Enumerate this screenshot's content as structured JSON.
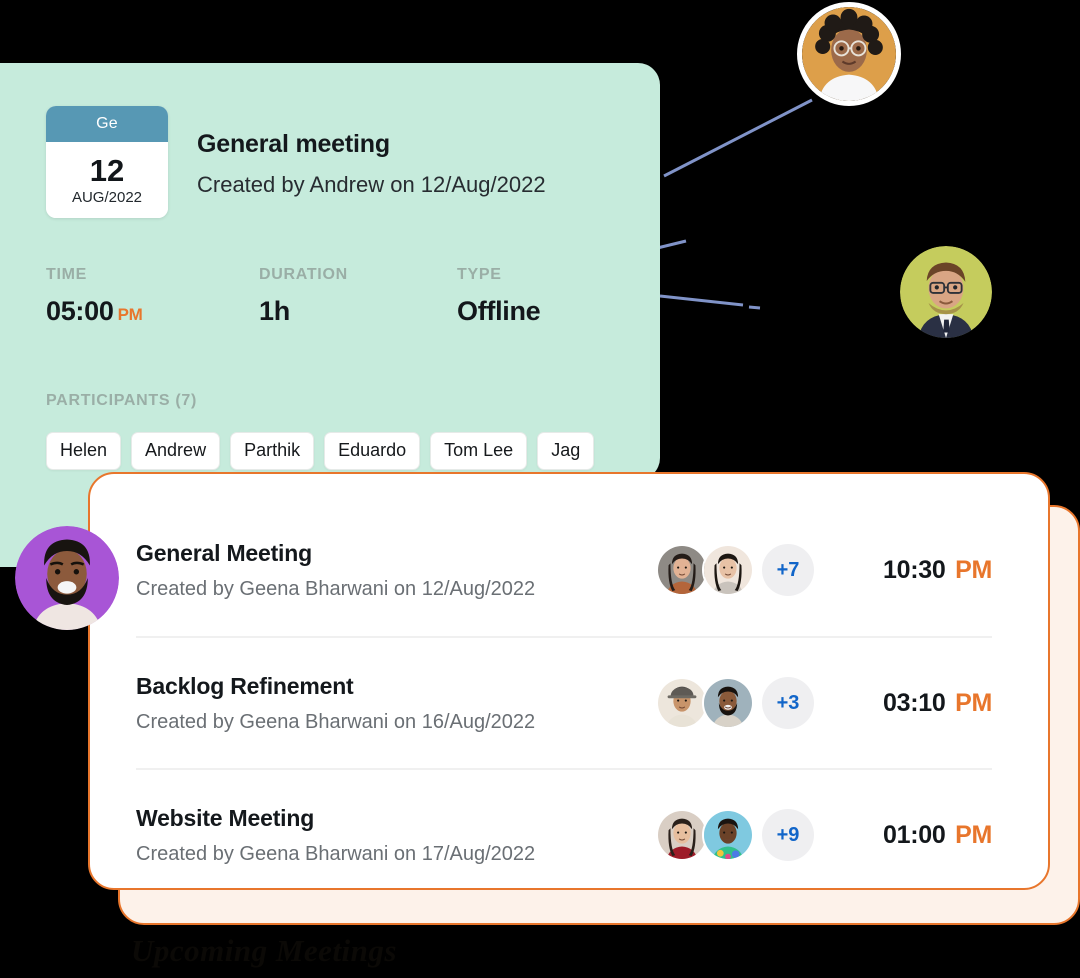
{
  "theme": {
    "background": "#000000",
    "mint_card_bg": "#C6EBDC",
    "badge_header_bg": "#5798B4",
    "accent_orange": "#E8762C",
    "back_card_bg": "#FDF2EA",
    "blue_count": "#1165C9",
    "muted_label": "#9AAEA6",
    "connector_line": "#8093C8"
  },
  "detail_card": {
    "badge": {
      "header_label": "Ge",
      "day": "12",
      "month_year": "AUG/2022"
    },
    "title": "General meeting",
    "subtitle": "Created by Andrew on 12/Aug/2022",
    "meta": [
      {
        "label": "TIME",
        "value": "05:00",
        "suffix": "PM"
      },
      {
        "label": "DURATION",
        "value": "1h",
        "suffix": ""
      },
      {
        "label": "TYPE",
        "value": "Offline",
        "suffix": ""
      }
    ],
    "participants": {
      "label": "PARTICIPANTS (7)",
      "count": 7,
      "chips": [
        "Helen",
        "Andrew",
        "Parthik",
        "Eduardo",
        "Tom Lee",
        "Jag"
      ]
    }
  },
  "meeting_list": {
    "rows": [
      {
        "title": "General Meeting",
        "subtitle": "Created by Geena Bharwani on 12/Aug/2022",
        "more_count": "+7",
        "time": "10:30",
        "ampm": "PM",
        "avatars": [
          "avatar-woman-dark-hair-photo",
          "avatar-woman-long-hair-photo"
        ]
      },
      {
        "title": "Backlog Refinement",
        "subtitle": "Created by Geena Bharwani on 16/Aug/2022",
        "more_count": "+3",
        "time": "03:10",
        "ampm": "PM",
        "avatars": [
          "avatar-man-cap-photo",
          "avatar-man-beard-photo"
        ]
      },
      {
        "title": "Website Meeting",
        "subtitle": "Created by Geena Bharwani on 17/Aug/2022",
        "more_count": "+9",
        "time": "01:00",
        "ampm": "PM",
        "avatars": [
          "avatar-woman-red-top-photo",
          "avatar-man-colorful-shirt-photo"
        ]
      }
    ]
  },
  "floating_avatars": [
    {
      "name": "avatar-curly-hair-glasses-woman",
      "bg": "#DD9F4A"
    },
    {
      "name": "avatar-suit-glasses-man",
      "bg": "#C5CC5D"
    },
    {
      "name": "avatar-smiling-bearded-man",
      "bg": "#A855D6"
    }
  ],
  "watermark": {
    "text": "Upcoming Meetings"
  }
}
